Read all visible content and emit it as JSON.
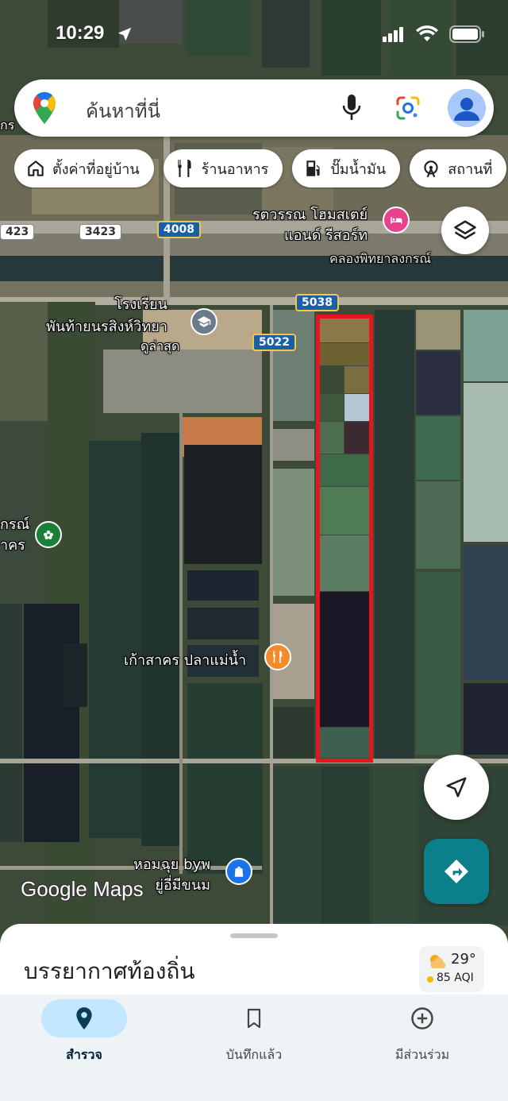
{
  "status_bar": {
    "time": "10:29"
  },
  "search": {
    "placeholder": "ค้นหาที่นี่"
  },
  "chips": [
    {
      "label": "ตั้งค่าที่อยู่บ้าน",
      "icon": "home-icon"
    },
    {
      "label": "ร้านอาหาร",
      "icon": "restaurant-icon"
    },
    {
      "label": "ปั๊มน้ำมัน",
      "icon": "gas-station-icon"
    },
    {
      "label": "สถานที่",
      "icon": "attraction-icon"
    }
  ],
  "map": {
    "labels": {
      "resort": "รตวรรณ โฮมสเตย์\nแอนด์ รีสอร์ท",
      "canal": "คลองพิทยาลงกรณ์",
      "school": "โรงเรียน\nพันท้ายนรสิงห์วิทยา",
      "school_sub": "ดูล่าสุด",
      "restaurant": "เก้าสาคร ปลาแม่น้ำ",
      "shop": "หอมฉุย byพ\nยู่อี่มีขนม",
      "left_edge_top": "กร",
      "left_edge_mid": "กรณ์\nาคร"
    },
    "roads": {
      "r3423": "3423",
      "r423": "423",
      "r4008": "4008",
      "r5038": "5038",
      "r5022": "5022"
    },
    "branding": "Google Maps",
    "highlight_color": "#e4161e"
  },
  "bottom_sheet": {
    "title": "บรรยากาศท้องถิ่น",
    "weather": {
      "temp": "29°",
      "aqi": "85 AQI"
    }
  },
  "bottom_nav": [
    {
      "label": "สำรวจ",
      "icon": "explore-pin-icon",
      "active": true
    },
    {
      "label": "บันทึกแล้ว",
      "icon": "bookmark-icon",
      "active": false
    },
    {
      "label": "มีส่วนร่วม",
      "icon": "contribute-plus-icon",
      "active": false
    }
  ],
  "colors": {
    "accent": "#0b7f8a",
    "nav_active_bg": "#c2e7ff",
    "restaurant_poi": "#f28b2c",
    "hotel_poi": "#e8428c",
    "shop_poi": "#1a73e8"
  }
}
